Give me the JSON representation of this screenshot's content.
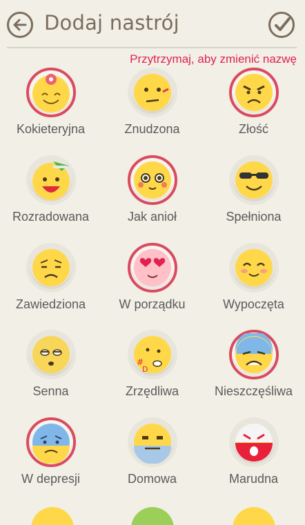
{
  "header": {
    "title": "Dodaj nastrój",
    "hint": "Przytrzymaj, aby zmienić nazwę"
  },
  "moods": [
    {
      "label": "Kokieteryjna",
      "icon": "flirty-face-icon",
      "selected": true
    },
    {
      "label": "Znudzona",
      "icon": "bored-face-icon",
      "selected": false
    },
    {
      "label": "Złość",
      "icon": "angry-face-icon",
      "selected": true
    },
    {
      "label": "Rozradowana",
      "icon": "overjoyed-face-icon",
      "selected": false
    },
    {
      "label": "Jak anioł",
      "icon": "angel-face-icon",
      "selected": true
    },
    {
      "label": "Spełniona",
      "icon": "fulfilled-face-icon",
      "selected": false
    },
    {
      "label": "Zawiedziona",
      "icon": "disappointed-face-icon",
      "selected": false
    },
    {
      "label": "W porządku",
      "icon": "heart-eyes-face-icon",
      "selected": true
    },
    {
      "label": "Wypoczęta",
      "icon": "rested-face-icon",
      "selected": false
    },
    {
      "label": "Senna",
      "icon": "sleepy-face-icon",
      "selected": false
    },
    {
      "label": "Zrzędliwa",
      "icon": "grumpy-face-icon",
      "selected": false
    },
    {
      "label": "Nieszczęśliwa",
      "icon": "unhappy-face-icon",
      "selected": true
    },
    {
      "label": "W depresji",
      "icon": "depressed-face-icon",
      "selected": true
    },
    {
      "label": "Domowa",
      "icon": "homely-face-icon",
      "selected": false
    },
    {
      "label": "Marudna",
      "icon": "whiny-face-icon",
      "selected": false
    }
  ],
  "colors": {
    "accent_hint": "#e0224f",
    "selected_ring": "#d94b5f",
    "face_yellow": "#ffd84a"
  }
}
